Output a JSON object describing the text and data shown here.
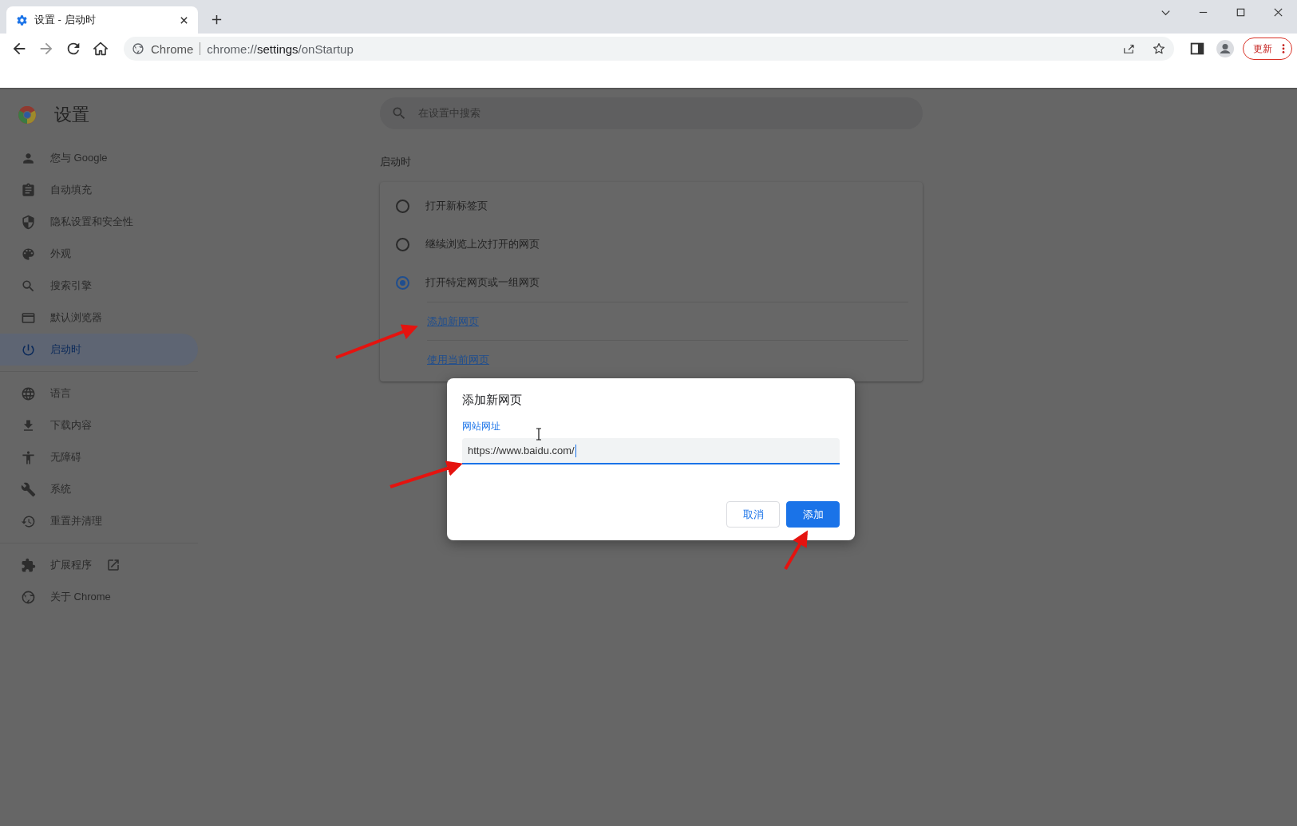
{
  "browser": {
    "tab": {
      "title": "设置 - 启动时"
    },
    "address": {
      "site_label": "Chrome",
      "url_scheme": "chrome://",
      "url_host": "settings",
      "url_path": "/onStartup"
    },
    "update_button": "更新"
  },
  "settings": {
    "title": "设置",
    "search": {
      "placeholder": "在设置中搜索"
    },
    "sidebar": {
      "groups": [
        [
          {
            "label": "您与 Google",
            "selected": false,
            "opens_externally": false
          },
          {
            "label": "自动填充",
            "selected": false,
            "opens_externally": false
          },
          {
            "label": "隐私设置和安全性",
            "selected": false,
            "opens_externally": false
          },
          {
            "label": "外观",
            "selected": false,
            "opens_externally": false
          },
          {
            "label": "搜索引擎",
            "selected": false,
            "opens_externally": false
          },
          {
            "label": "默认浏览器",
            "selected": false,
            "opens_externally": false
          },
          {
            "label": "启动时",
            "selected": true,
            "opens_externally": false
          }
        ],
        [
          {
            "label": "语言",
            "selected": false,
            "opens_externally": false
          },
          {
            "label": "下载内容",
            "selected": false,
            "opens_externally": false
          },
          {
            "label": "无障碍",
            "selected": false,
            "opens_externally": false
          },
          {
            "label": "系统",
            "selected": false,
            "opens_externally": false
          },
          {
            "label": "重置并清理",
            "selected": false,
            "opens_externally": false
          }
        ],
        [
          {
            "label": "扩展程序",
            "selected": false,
            "opens_externally": true
          },
          {
            "label": "关于 Chrome",
            "selected": false,
            "opens_externally": false
          }
        ]
      ]
    },
    "section_title": "启动时",
    "startup_options": [
      {
        "label": "打开新标签页",
        "selected": false
      },
      {
        "label": "继续浏览上次打开的网页",
        "selected": false
      },
      {
        "label": "打开特定网页或一组网页",
        "selected": true
      }
    ],
    "links": [
      "添加新网页",
      "使用当前网页"
    ]
  },
  "dialog": {
    "title": "添加新网页",
    "field": {
      "label": "网站网址",
      "value": "https://www.baidu.com/"
    },
    "buttons": [
      "取消",
      "添加"
    ]
  }
}
